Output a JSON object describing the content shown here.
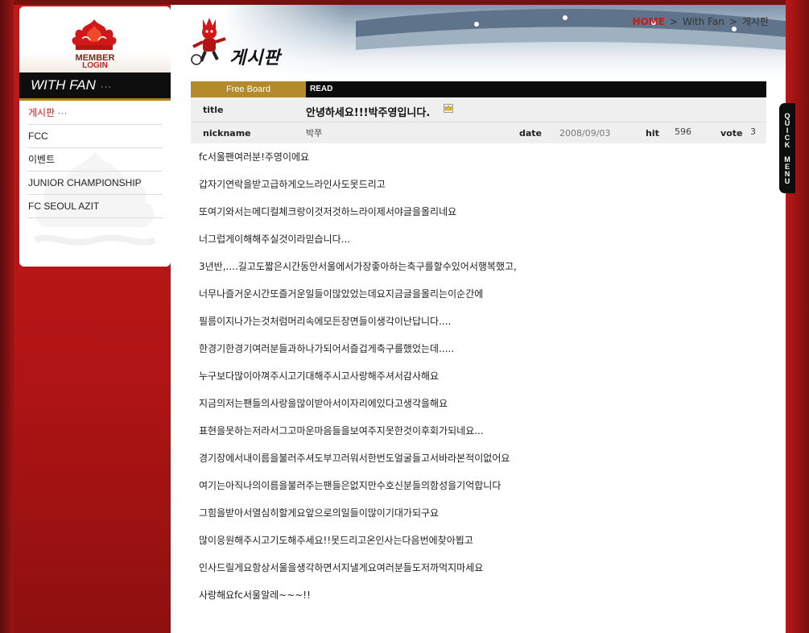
{
  "sidebar": {
    "login": {
      "member": "MEMBER",
      "login": "LOGIN"
    },
    "section_title": "WITH FAN",
    "section_dots": "···",
    "menu": [
      {
        "label": "게시판 ···",
        "active": true
      },
      {
        "label": "FCC",
        "active": false
      },
      {
        "label": "이벤트",
        "active": false
      },
      {
        "label": "JUNIOR CHAMPIONSHIP",
        "active": false
      },
      {
        "label": "FC SEOUL AZIT",
        "active": false
      }
    ]
  },
  "header": {
    "page_title": "게시판",
    "breadcrumb": {
      "home": "HOME",
      "sep1": ">",
      "section": "With Fan",
      "sep2": ">",
      "page": "게시판"
    }
  },
  "board": {
    "tab_label": "Free Board",
    "mode_label": "READ",
    "title_label": "title",
    "title_value": "안녕하세요!!!박주영입니다.",
    "nickname_label": "nickname",
    "nickname_value": "박쭈",
    "date_label": "date",
    "date_value": "2008/09/03",
    "hit_label": "hit",
    "hit_value": "596",
    "vote_label": "vote",
    "vote_value": "3"
  },
  "post_lines": [
    "fc서울팬여러분!주영이에요",
    "갑자기연락을받고급하게오느라인사도못드리고",
    "또여기와서는메디컬체크랑이것저것하느라이제서야글을올리네요",
    "너그럽게이해해주실것이라믿습니다...",
    "3년반,....길고도짧은시간동안서울에서가장좋아하는축구를할수있어서행복했고,",
    "너무나즐거운시간또즐거운일들이많았었는데요지금글을올리는이순간에",
    "필름이지나가는것처럼머리속에모든장면들이생각이난답니다....",
    "한경기한경기여러분들과하나가되어서즐겁게축구를했었는데.....",
    "누구보다많이아껴주시고기대해주시고사랑해주셔서감사해요",
    "지금의저는팬들의사랑을많이받아서이자리에있다고생각을해요",
    "표현을못하는저라서그고마운마음들을보여주지못한것이후회가되네요...",
    "경기장에서내이름을불러주셔도부끄러워서한번도얼굴들고서바라본적이없어요",
    "여기는아직나의이름을불러주는팬들은없지만수호신분들의함성을기억합니다",
    "그힘을받아서열심히할게요앞으로의일들이많이기대가되구요",
    "많이응원해주시고기도해주세요!!못드리고온인사는다음번에찾아뵙고",
    "인사드릴게요항상서울을생각하면서지낼게요여러분들도저까먹지마세요",
    "사랑해요fc서울알레~~~!!"
  ],
  "quick_menu": {
    "letters": [
      "Q",
      "U",
      "I",
      "C",
      "K",
      "",
      "M",
      "E",
      "N",
      "U"
    ]
  },
  "colors": {
    "brand_red": "#c81c1c",
    "gold": "#b48a2a",
    "dark": "#0e0e0e"
  }
}
